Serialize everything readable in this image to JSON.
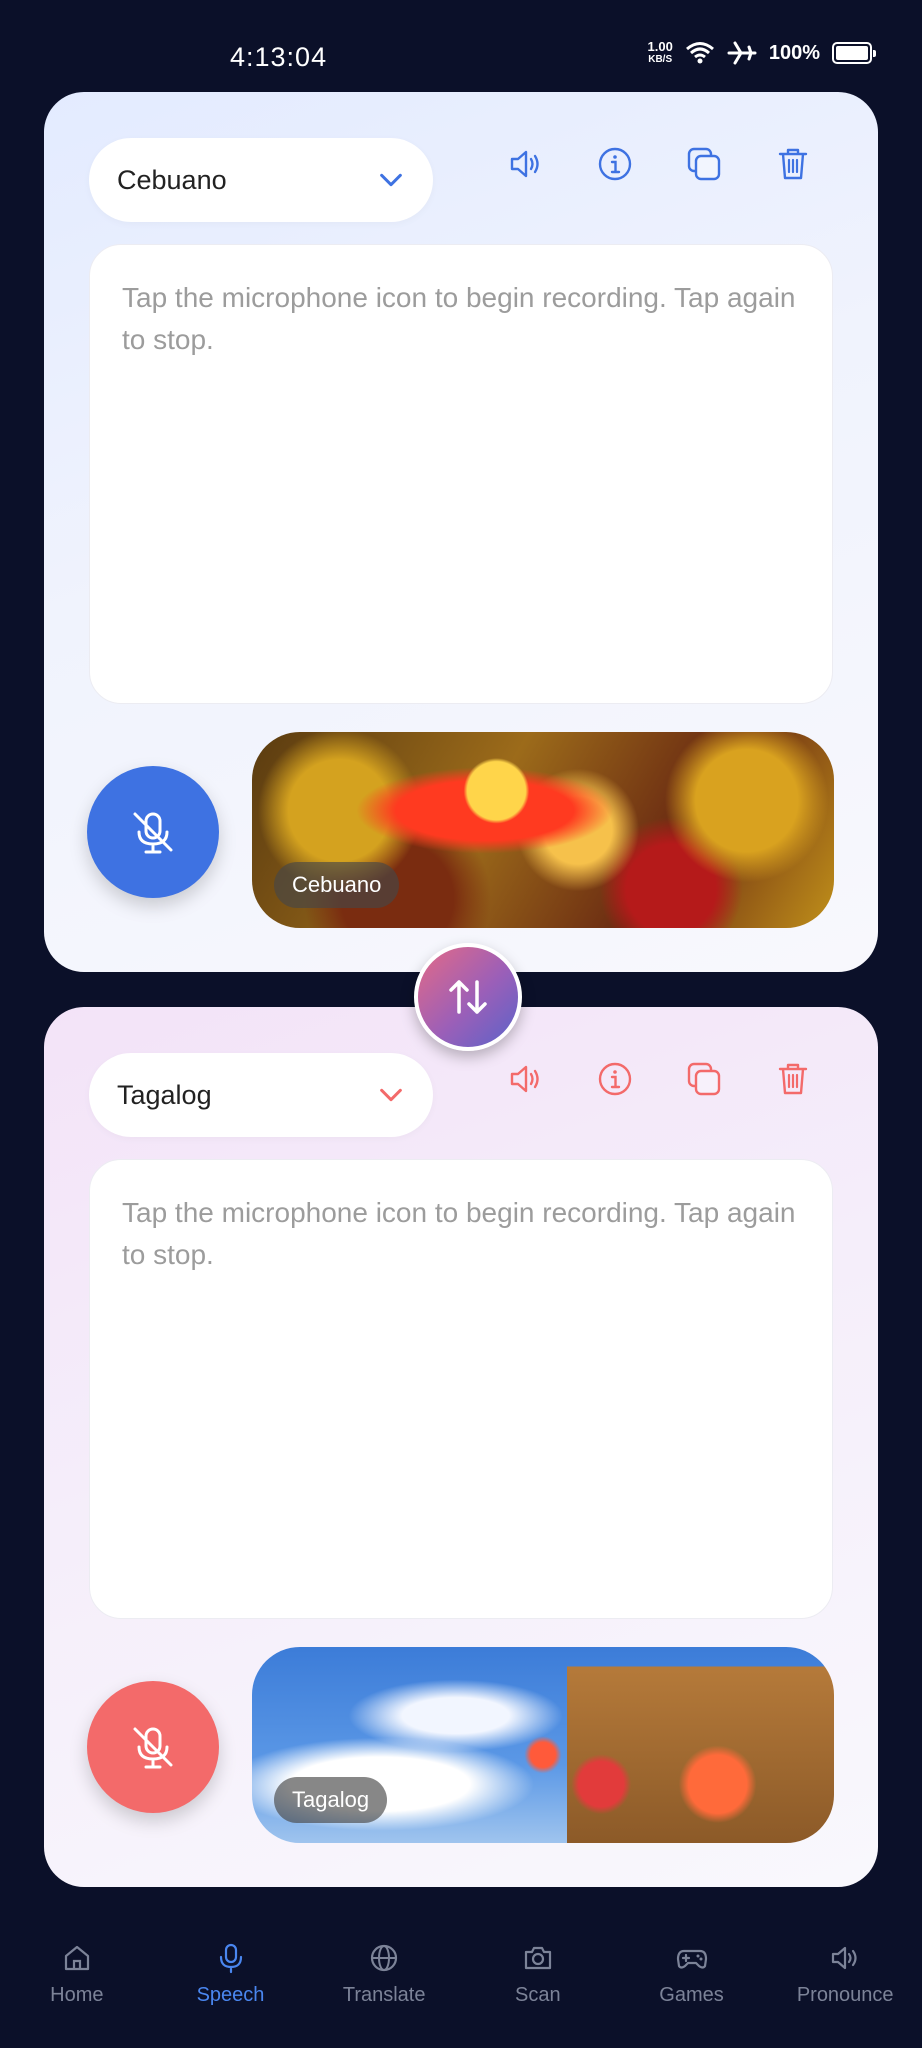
{
  "status_bar": {
    "time": "4:13:04",
    "net_speed_value": "1.00",
    "net_speed_unit": "KB/S",
    "battery": "100%"
  },
  "colors": {
    "primary_blue": "#3e72e2",
    "primary_red": "#f36a6a",
    "nav_active": "#4a86ef",
    "background": "#0b1029"
  },
  "source_panel": {
    "language": "Cebuano",
    "placeholder": "Tap the microphone icon to begin recording. Tap again to stop.",
    "image_label": "Cebuano",
    "icons": [
      "speaker-icon",
      "info-icon",
      "copy-icon",
      "trash-icon"
    ]
  },
  "target_panel": {
    "language": "Tagalog",
    "placeholder": "Tap the microphone icon to begin recording. Tap again to stop.",
    "image_label": "Tagalog",
    "icons": [
      "speaker-icon",
      "info-icon",
      "copy-icon",
      "trash-icon"
    ]
  },
  "nav": {
    "items": [
      {
        "label": "Home",
        "icon": "home-icon"
      },
      {
        "label": "Speech",
        "icon": "microphone-icon",
        "active": true
      },
      {
        "label": "Translate",
        "icon": "globe-icon"
      },
      {
        "label": "Scan",
        "icon": "camera-icon"
      },
      {
        "label": "Games",
        "icon": "gamepad-icon"
      },
      {
        "label": "Pronounce",
        "icon": "speaker-icon"
      }
    ]
  }
}
